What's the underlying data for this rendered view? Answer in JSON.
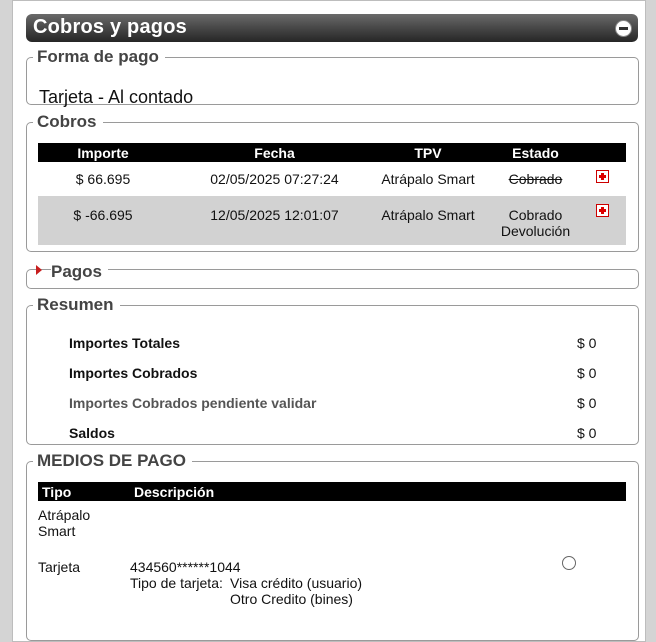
{
  "panel": {
    "title": "Cobros y pagos"
  },
  "forma_pago": {
    "legend": "Forma de pago",
    "value": "Tarjeta - Al contado"
  },
  "cobros": {
    "legend": "Cobros",
    "columns": [
      "Importe",
      "Fecha",
      "TPV",
      "Estado"
    ],
    "rows": [
      {
        "importe": "$ 66.695",
        "fecha": "02/05/2025 07:27:24",
        "tpv": "Atrápalo Smart",
        "estado": [
          "Cobrado"
        ]
      },
      {
        "importe": "$ -66.695",
        "fecha": "12/05/2025 12:01:07",
        "tpv": "Atrápalo Smart",
        "estado": [
          "Cobrado",
          "Devolución"
        ]
      }
    ],
    "colors": {
      "header_bg": "#000000",
      "alt_row_bg": "#d2d2d2",
      "status_green": "#1a8a1a",
      "expand_red": "#dd0000"
    }
  },
  "pagos": {
    "legend": "Pagos"
  },
  "resumen": {
    "legend": "Resumen",
    "rows": [
      {
        "label": "Importes Totales",
        "value": "$ 0"
      },
      {
        "label": "Importes Cobrados",
        "value": "$ 0"
      },
      {
        "label": "Importes Cobrados pendiente validar",
        "value": "$ 0"
      },
      {
        "label": "Saldos",
        "value": "$ 0"
      }
    ]
  },
  "medios_pago": {
    "legend": "MEDIOS DE PAGO",
    "columns": [
      "Tipo",
      "Descripción"
    ],
    "item1": {
      "tipo_line1": "Atrápalo",
      "tipo_line2": "Smart"
    },
    "item2": {
      "tipo": "Tarjeta",
      "number": "434560******1044",
      "card_type_label": "Tipo de tarjeta:",
      "card_type_1": "Visa crédito (usuario)",
      "card_type_2": "Otro Credito (bines)"
    }
  }
}
